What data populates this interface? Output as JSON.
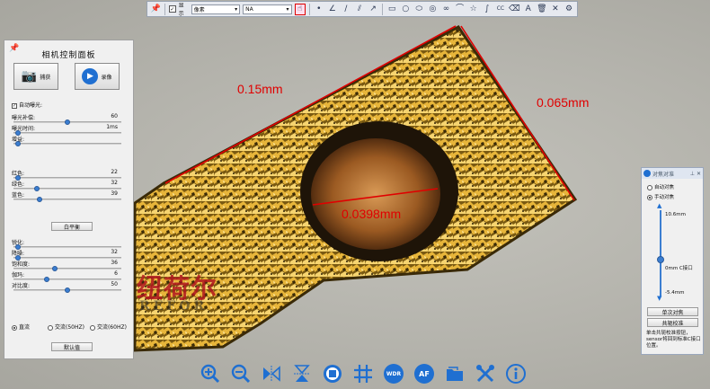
{
  "top_toolbar": {
    "show_label": "显示",
    "show_checked": true,
    "select_1": "像素",
    "select_2": "NA",
    "icons": [
      "pin-icon",
      "select-icon",
      "dot-icon",
      "angle-icon",
      "line-icon",
      "parallel-icon",
      "arrow-icon",
      "rectangle-icon",
      "circle-icon",
      "ellipse-icon",
      "concentric-circle-icon",
      "link-icon",
      "arc-icon",
      "star-icon",
      "curve-icon",
      "cc-label",
      "eraser-icon",
      "text-icon",
      "delete-icon",
      "close-icon",
      "settings-icon"
    ]
  },
  "camera_panel": {
    "title": "相机控制面板",
    "capture_label": "捕获",
    "record_label": "录像",
    "auto_exposure_label": "自动曝光:",
    "auto_exposure_checked": true,
    "rows_top": [
      {
        "label": "曝光补偿:",
        "value": "60",
        "level": 0.5
      },
      {
        "label": "曝光时间:",
        "value": "1ms",
        "level": 0.02
      },
      {
        "label": "增益:",
        "value": "",
        "level": 0.02
      }
    ],
    "rows_color": [
      {
        "label": "红色:",
        "value": "22",
        "level": 0.02
      },
      {
        "label": "绿色:",
        "value": "32",
        "level": 0.2
      },
      {
        "label": "蓝色:",
        "value": "39",
        "level": 0.23
      }
    ],
    "white_balance_label": "白平衡",
    "rows_image": [
      {
        "label": "锐化:",
        "value": "",
        "level": 0.02
      },
      {
        "label": "降噪:",
        "value": "32",
        "level": 0.02
      },
      {
        "label": "饱和度:",
        "value": "36",
        "level": 0.38
      },
      {
        "label": "伽玛:",
        "value": "6",
        "level": 0.3
      },
      {
        "label": "对比度:",
        "value": "50",
        "level": 0.5
      }
    ],
    "power_options": [
      {
        "label": "直流",
        "selected": true
      },
      {
        "label": "交流(50HZ)",
        "selected": false
      },
      {
        "label": "交流(60HZ)",
        "selected": false
      }
    ],
    "default_label": "默认值"
  },
  "focus_panel": {
    "title": "对焦对准",
    "auto_label": "自动对焦",
    "manual_label": "手动对焦",
    "manual_selected": true,
    "top_value": "10.6mm",
    "mid_value": "0mm C接口",
    "bottom_value": "-5.4mm",
    "level": 0.55,
    "single_focus_label": "单次对焦",
    "calibrate_label": "共轭校准",
    "note": "单击共轭校准按钮，sensor将回到标准C接口位置。"
  },
  "measurements": {
    "length_label": "0.15mm",
    "width_label": "0.065mm",
    "hole_label": "0.0398mm"
  },
  "watermark": {
    "text": "纽荷尔",
    "sub": "REFOR"
  },
  "bottom_toolbar": {
    "icons": [
      "zoom-in-icon",
      "zoom-out-icon",
      "flip-horizontal-icon",
      "flip-vertical-icon",
      "stop-icon",
      "grid-icon",
      "wdr-icon",
      "af-icon",
      "folder-icon",
      "tools-icon",
      "info-icon"
    ],
    "wdr_label": "WDR",
    "af_label": "AF"
  },
  "colors": {
    "measure_red": "#e00000",
    "accent_blue": "#1f6fd1"
  }
}
